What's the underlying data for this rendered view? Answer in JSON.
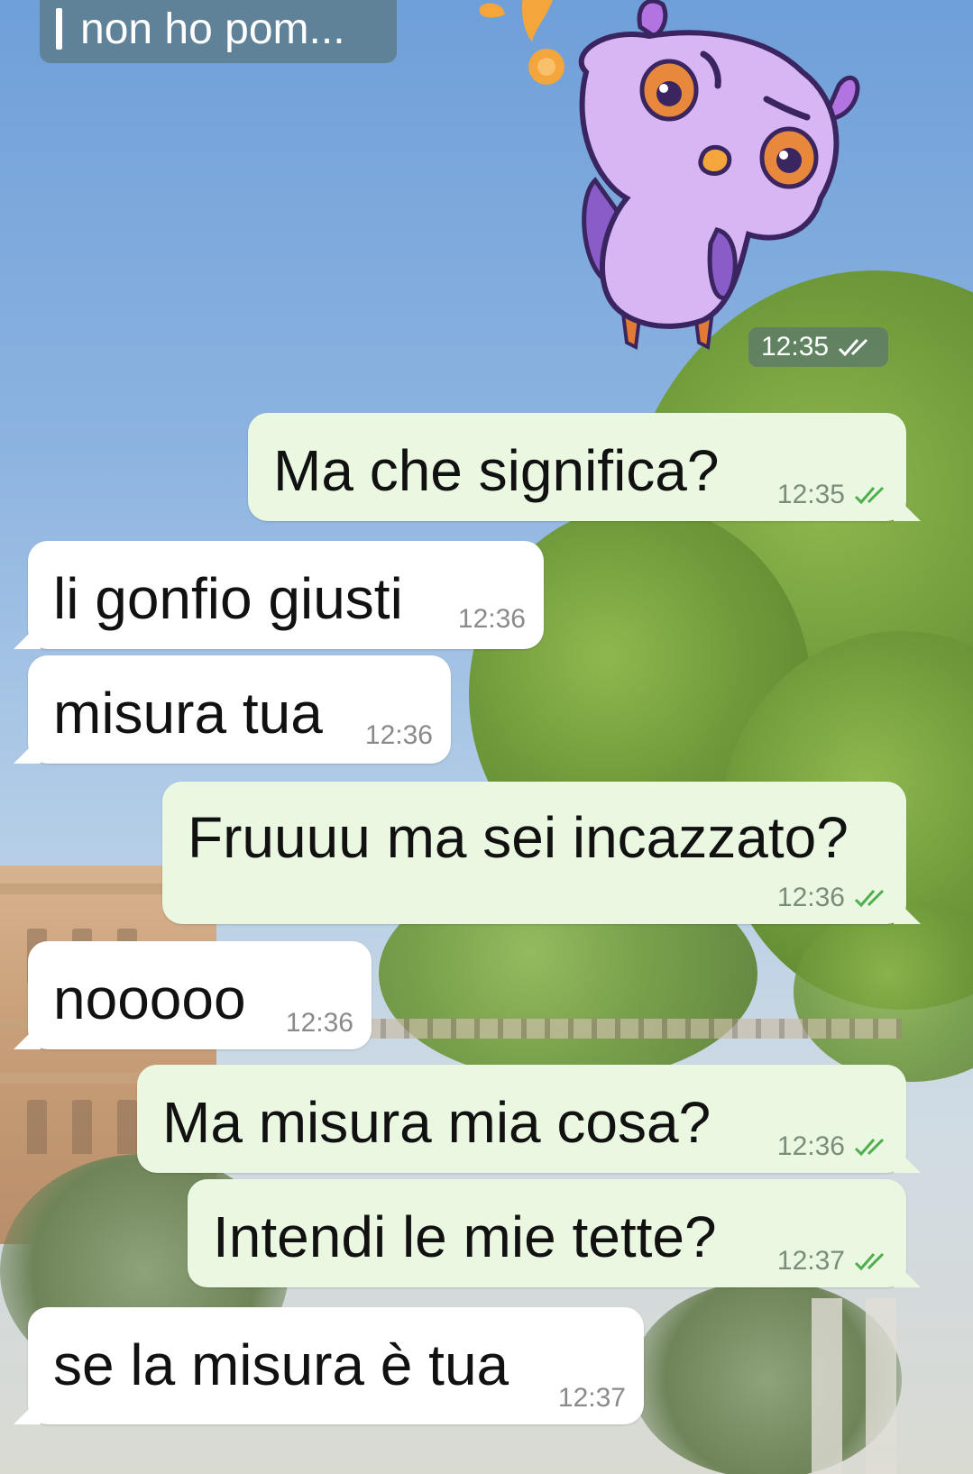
{
  "chat": {
    "reply_preview": {
      "text": "non ho pom..."
    },
    "sticker": {
      "icon": "owl-sticker-icon",
      "time": "12:35",
      "status": "read"
    },
    "messages": [
      {
        "direction": "out",
        "text": "Ma che significa?",
        "time": "12:35",
        "status": "read"
      },
      {
        "direction": "in",
        "text": "li gonfio giusti",
        "time": "12:36"
      },
      {
        "direction": "in",
        "text": "misura tua",
        "time": "12:36"
      },
      {
        "direction": "out",
        "text": "Fruuuu ma sei incazzato?",
        "time": "12:36",
        "status": "read"
      },
      {
        "direction": "in",
        "text": "nooooo",
        "time": "12:36"
      },
      {
        "direction": "out",
        "text": "Ma misura mia cosa?",
        "time": "12:36",
        "status": "read"
      },
      {
        "direction": "out",
        "text": "Intendi le mie tette?",
        "time": "12:37",
        "status": "read"
      },
      {
        "direction": "in",
        "text": "se la misura è tua",
        "time": "12:37"
      }
    ]
  },
  "colors": {
    "incoming_bubble": "#ffffff",
    "outgoing_bubble": "#eaf7e1",
    "read_ticks": "#4fae4e",
    "sticker_read_ticks": "#ffffff"
  }
}
